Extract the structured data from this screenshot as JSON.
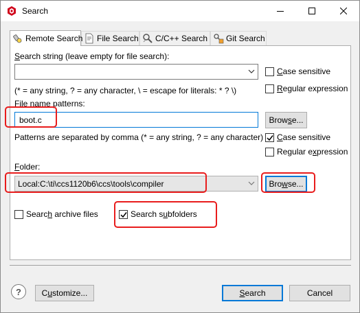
{
  "window": {
    "title": "Search",
    "controls": {
      "minimize": "minimize-icon",
      "maximize": "maximize-icon",
      "close": "close-icon"
    }
  },
  "tabs": [
    {
      "label": "Remote Search",
      "icon": "search-flashlight-icon",
      "active": true
    },
    {
      "label": "File Search",
      "icon": "file-search-icon",
      "active": false
    },
    {
      "label": "C/C++ Search",
      "icon": "cpp-search-icon",
      "active": false
    },
    {
      "label": "Git Search",
      "icon": "git-search-icon",
      "active": false
    }
  ],
  "search_string": {
    "label_pre": "",
    "label_mnemonic": "S",
    "label_post": "earch string (leave empty for file search):",
    "value": "",
    "hint": "(* = any string, ? = any character, \\ = escape for literals: * ? \\)",
    "case_sensitive": {
      "label_mnemonic": "C",
      "label_post": "ase sensitive",
      "checked": false
    },
    "regular_expression": {
      "label_pre": "",
      "label_mnemonic": "R",
      "label_post": "egular expression",
      "checked": false
    }
  },
  "file_name": {
    "label_mnemonic": "F",
    "label_post": "ile name patterns:",
    "value": "boot.c",
    "browse_label_pre": "Brow",
    "browse_label_mnemonic": "s",
    "browse_label_post": "e...",
    "hint": "Patterns are separated by comma (* = any string, ? = any character)",
    "case_sensitive": {
      "label_mnemonic": "C",
      "label_post": "ase sensitive",
      "checked": true
    },
    "regular_expression": {
      "label_mnemonic": "",
      "label_pre": "Regular e",
      "label_mnemonic2": "x",
      "label_post": "pression",
      "checked": false
    }
  },
  "folder": {
    "label_mnemonic": "F",
    "label_post": "older:",
    "value": "Local:C:\\ti\\ccs1120b6\\ccs\\tools\\compiler",
    "browse_label_pre": "Bro",
    "browse_label_mnemonic": "w",
    "browse_label_post": "se..."
  },
  "options": {
    "archive": {
      "label_pre": "Searc",
      "label_mnemonic": "h",
      "label_post": " archive files",
      "checked": false
    },
    "subfolders": {
      "label_pre": "Search s",
      "label_mnemonic": "u",
      "label_post": "bfolders",
      "checked": true
    }
  },
  "footer": {
    "help_glyph": "?",
    "customize_label_pre": "C",
    "customize_label_mnemonic": "u",
    "customize_label_post": "stomize...",
    "search_label_mnemonic": "S",
    "search_label_post": "earch",
    "cancel_label": "Cancel"
  },
  "colors": {
    "highlight": "#e81b1b",
    "accent": "#0078d7",
    "app_icon": "#d0021b"
  }
}
